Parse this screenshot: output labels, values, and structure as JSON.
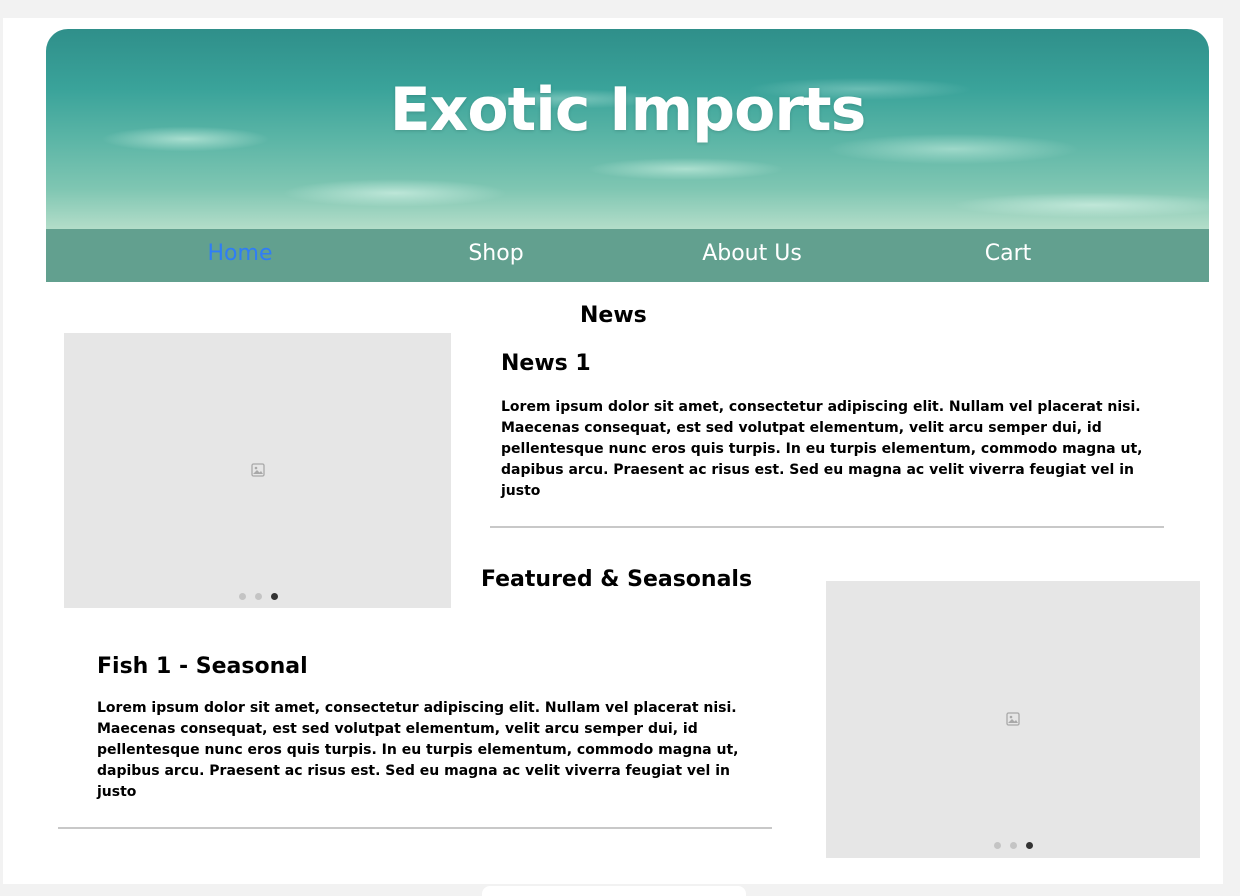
{
  "header": {
    "title": "Exotic Imports"
  },
  "nav": {
    "items": [
      {
        "label": "Home",
        "active": true
      },
      {
        "label": "Shop",
        "active": false
      },
      {
        "label": "About Us",
        "active": false
      },
      {
        "label": "Cart",
        "active": false
      }
    ]
  },
  "news": {
    "heading": "News",
    "carousel": {
      "slides": 3,
      "active_slide": 3,
      "icon": "image-icon"
    },
    "article": {
      "title": "News 1",
      "body": "Lorem ipsum dolor sit amet, consectetur adipiscing elit. Nullam vel placerat nisi. Maecenas consequat, est sed volutpat elementum, velit arcu semper dui, id pellentesque nunc eros quis turpis. In eu turpis elementum, commodo magna ut, dapibus arcu. Praesent ac risus est. Sed eu magna ac velit viverra feugiat vel in justo"
    }
  },
  "featured": {
    "heading": "Featured & Seasonals",
    "carousel": {
      "slides": 3,
      "active_slide": 3,
      "icon": "image-icon"
    },
    "article": {
      "title": "Fish 1 - Seasonal",
      "body": "Lorem ipsum dolor sit amet, consectetur adipiscing elit. Nullam vel placerat nisi. Maecenas consequat, est sed volutpat elementum, velit arcu semper dui, id pellentesque nunc eros quis turpis. In eu turpis elementum, commodo magna ut, dapibus arcu. Praesent ac risus est. Sed eu magna ac velit viverra feugiat vel in justo"
    }
  },
  "colors": {
    "nav_background": "#62a08f",
    "nav_active": "#2f7df6",
    "nav_text": "#ffffff",
    "placeholder": "#e6e6e6",
    "rule": "#c8c8c8"
  }
}
